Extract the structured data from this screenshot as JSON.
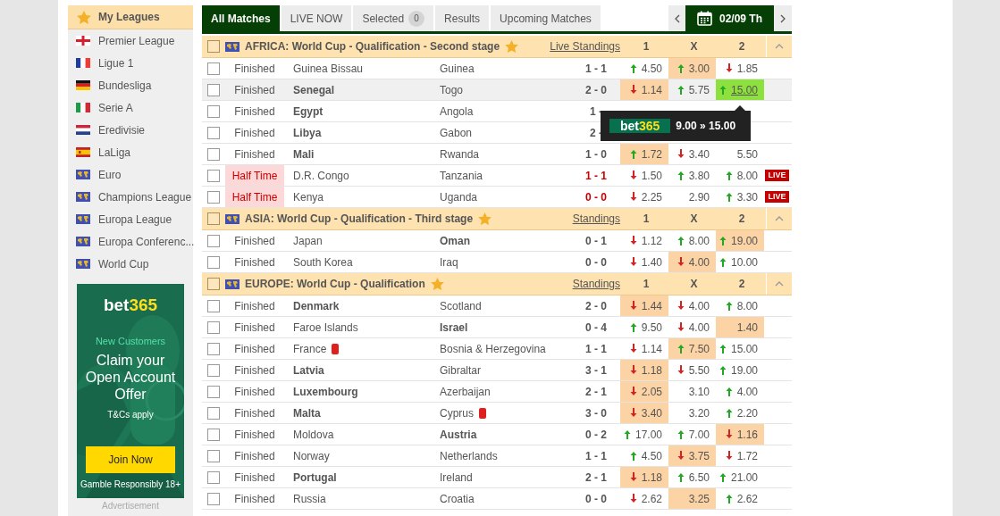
{
  "sidebar": {
    "title": "My Leagues",
    "items": [
      {
        "label": "Premier League",
        "kind": "england"
      },
      {
        "label": "Ligue 1",
        "kind": "france"
      },
      {
        "label": "Bundesliga",
        "kind": "germany"
      },
      {
        "label": "Serie A",
        "kind": "italy"
      },
      {
        "label": "Eredivisie",
        "kind": "netherlands"
      },
      {
        "label": "LaLiga",
        "kind": "spain"
      },
      {
        "label": "Euro",
        "kind": "world"
      },
      {
        "label": "Champions League",
        "kind": "world"
      },
      {
        "label": "Europa League",
        "kind": "world"
      },
      {
        "label": "Europa Conferenc...",
        "kind": "world"
      },
      {
        "label": "World Cup",
        "kind": "world"
      }
    ]
  },
  "ad": {
    "brand": "bet",
    "brand_accent": "365",
    "kicker": "New Customers",
    "headline": "Claim your Open Account Offer",
    "terms": "T&Cs apply",
    "button": "Join Now",
    "footer": "Gamble Responsibly 18+",
    "caption": "Advertisement"
  },
  "tabs": [
    {
      "label": "All Matches",
      "selected": true
    },
    {
      "label": "LIVE NOW",
      "selected": false
    },
    {
      "label": "Selected",
      "selected": false,
      "count": "0"
    },
    {
      "label": "Results",
      "selected": false
    },
    {
      "label": "Upcoming Matches",
      "selected": false
    }
  ],
  "date": "02/09 Th",
  "groups": [
    {
      "title": "AFRICA: World Cup - Qualification - Second stage",
      "checked": false,
      "standings": "Live Standings",
      "columns": [
        "1",
        "X",
        "2"
      ],
      "rows": [
        {
          "checked": false,
          "status": "Finished",
          "live": false,
          "hovered": false,
          "home": {
            "name": "Guinea Bissau",
            "bold": false,
            "red_card": false
          },
          "away": {
            "name": "Guinea",
            "bold": false,
            "red_card": false
          },
          "score": "1 - 1",
          "odds": [
            {
              "value": "4.50",
              "kind": "up",
              "highlighted": false,
              "selected": false
            },
            {
              "value": "3.00",
              "kind": "up",
              "highlighted": true,
              "selected": false
            },
            {
              "value": "1.85",
              "kind": "down",
              "highlighted": false,
              "selected": false
            }
          ]
        },
        {
          "checked": false,
          "status": "Finished",
          "live": false,
          "hovered": true,
          "home": {
            "name": "Senegal",
            "bold": true,
            "red_card": false
          },
          "away": {
            "name": "Togo",
            "bold": false,
            "red_card": false
          },
          "score": "2 - 0",
          "odds": [
            {
              "value": "1.14",
              "kind": "down",
              "highlighted": true,
              "selected": false
            },
            {
              "value": "5.75",
              "kind": "up",
              "highlighted": false,
              "selected": false
            },
            {
              "value": "15.00",
              "kind": "up",
              "highlighted": false,
              "selected": true
            }
          ]
        },
        {
          "checked": false,
          "status": "Finished",
          "live": false,
          "hovered": false,
          "home": {
            "name": "Egypt",
            "bold": true,
            "red_card": false
          },
          "away": {
            "name": "Angola",
            "bold": false,
            "red_card": false
          },
          "score": "1 -"
        },
        {
          "checked": false,
          "status": "Finished",
          "live": false,
          "hovered": false,
          "home": {
            "name": "Libya",
            "bold": true,
            "red_card": false
          },
          "away": {
            "name": "Gabon",
            "bold": false,
            "red_card": false
          },
          "score": "2 -"
        },
        {
          "checked": false,
          "status": "Finished",
          "live": false,
          "hovered": false,
          "home": {
            "name": "Mali",
            "bold": true,
            "red_card": false
          },
          "away": {
            "name": "Rwanda",
            "bold": false,
            "red_card": false
          },
          "score": "1 - 0",
          "odds": [
            {
              "value": "1.72",
              "kind": "up",
              "highlighted": true,
              "selected": false
            },
            {
              "value": "3.40",
              "kind": "down",
              "highlighted": false,
              "selected": false
            },
            {
              "value": "5.50",
              "kind": "flat",
              "highlighted": false,
              "selected": false
            }
          ]
        },
        {
          "checked": false,
          "status": "Half Time",
          "live": true,
          "live_badge": "LIVE",
          "hovered": false,
          "home": {
            "name": "D.R. Congo",
            "bold": false,
            "red_card": false
          },
          "away": {
            "name": "Tanzania",
            "bold": false,
            "red_card": false
          },
          "score": "1 - 1",
          "odds": [
            {
              "value": "1.50",
              "kind": "down",
              "highlighted": false,
              "selected": false
            },
            {
              "value": "3.80",
              "kind": "up",
              "highlighted": false,
              "selected": false
            },
            {
              "value": "8.00",
              "kind": "up",
              "highlighted": false,
              "selected": false
            }
          ]
        },
        {
          "checked": false,
          "status": "Half Time",
          "live": true,
          "live_badge": "LIVE",
          "hovered": false,
          "home": {
            "name": "Kenya",
            "bold": false,
            "red_card": false
          },
          "away": {
            "name": "Uganda",
            "bold": false,
            "red_card": false
          },
          "score": "0 - 0",
          "odds": [
            {
              "value": "2.25",
              "kind": "down",
              "highlighted": false,
              "selected": false
            },
            {
              "value": "2.90",
              "kind": "flat",
              "highlighted": false,
              "selected": false
            },
            {
              "value": "3.30",
              "kind": "up",
              "highlighted": false,
              "selected": false
            }
          ]
        }
      ]
    },
    {
      "title": "ASIA: World Cup - Qualification - Third stage",
      "checked": false,
      "standings": "Standings",
      "columns": [
        "1",
        "X",
        "2"
      ],
      "rows": [
        {
          "checked": false,
          "status": "Finished",
          "live": false,
          "hovered": false,
          "home": {
            "name": "Japan",
            "bold": false,
            "red_card": false
          },
          "away": {
            "name": "Oman",
            "bold": true,
            "red_card": false
          },
          "score": "0 - 1",
          "odds": [
            {
              "value": "1.12",
              "kind": "down",
              "highlighted": false,
              "selected": false
            },
            {
              "value": "8.00",
              "kind": "up",
              "highlighted": false,
              "selected": false
            },
            {
              "value": "19.00",
              "kind": "up",
              "highlighted": true,
              "selected": false
            }
          ]
        },
        {
          "checked": false,
          "status": "Finished",
          "live": false,
          "hovered": false,
          "home": {
            "name": "South Korea",
            "bold": false,
            "red_card": false
          },
          "away": {
            "name": "Iraq",
            "bold": false,
            "red_card": false
          },
          "score": "0 - 0",
          "odds": [
            {
              "value": "1.40",
              "kind": "down",
              "highlighted": false,
              "selected": false
            },
            {
              "value": "4.00",
              "kind": "down",
              "highlighted": true,
              "selected": false
            },
            {
              "value": "10.00",
              "kind": "up",
              "highlighted": false,
              "selected": false
            }
          ]
        }
      ]
    },
    {
      "title": "EUROPE: World Cup - Qualification",
      "checked": false,
      "standings": "Standings",
      "columns": [
        "1",
        "X",
        "2"
      ],
      "rows": [
        {
          "checked": false,
          "status": "Finished",
          "live": false,
          "hovered": false,
          "home": {
            "name": "Denmark",
            "bold": true,
            "red_card": false
          },
          "away": {
            "name": "Scotland",
            "bold": false,
            "red_card": false
          },
          "score": "2 - 0",
          "odds": [
            {
              "value": "1.44",
              "kind": "down",
              "highlighted": true,
              "selected": false
            },
            {
              "value": "4.00",
              "kind": "down",
              "highlighted": false,
              "selected": false
            },
            {
              "value": "8.00",
              "kind": "up",
              "highlighted": false,
              "selected": false
            }
          ]
        },
        {
          "checked": false,
          "status": "Finished",
          "live": false,
          "hovered": false,
          "home": {
            "name": "Faroe Islands",
            "bold": false,
            "red_card": false
          },
          "away": {
            "name": "Israel",
            "bold": true,
            "red_card": false
          },
          "score": "0 - 4",
          "odds": [
            {
              "value": "9.50",
              "kind": "up",
              "highlighted": false,
              "selected": false
            },
            {
              "value": "4.00",
              "kind": "down",
              "highlighted": false,
              "selected": false
            },
            {
              "value": "1.40",
              "kind": "flat",
              "highlighted": true,
              "selected": false
            }
          ]
        },
        {
          "checked": false,
          "status": "Finished",
          "live": false,
          "hovered": false,
          "home": {
            "name": "France",
            "bold": false,
            "red_card": true
          },
          "away": {
            "name": "Bosnia & Herzegovina",
            "bold": false,
            "red_card": false
          },
          "score": "1 - 1",
          "odds": [
            {
              "value": "1.14",
              "kind": "down",
              "highlighted": false,
              "selected": false
            },
            {
              "value": "7.50",
              "kind": "up",
              "highlighted": true,
              "selected": false
            },
            {
              "value": "15.00",
              "kind": "up",
              "highlighted": false,
              "selected": false
            }
          ]
        },
        {
          "checked": false,
          "status": "Finished",
          "live": false,
          "hovered": false,
          "home": {
            "name": "Latvia",
            "bold": true,
            "red_card": false
          },
          "away": {
            "name": "Gibraltar",
            "bold": false,
            "red_card": false
          },
          "score": "3 - 1",
          "odds": [
            {
              "value": "1.18",
              "kind": "down",
              "highlighted": true,
              "selected": false
            },
            {
              "value": "5.50",
              "kind": "down",
              "highlighted": false,
              "selected": false
            },
            {
              "value": "19.00",
              "kind": "up",
              "highlighted": false,
              "selected": false
            }
          ]
        },
        {
          "checked": false,
          "status": "Finished",
          "live": false,
          "hovered": false,
          "home": {
            "name": "Luxembourg",
            "bold": true,
            "red_card": false
          },
          "away": {
            "name": "Azerbaijan",
            "bold": false,
            "red_card": false
          },
          "score": "2 - 1",
          "odds": [
            {
              "value": "2.05",
              "kind": "down",
              "highlighted": true,
              "selected": false
            },
            {
              "value": "3.10",
              "kind": "flat",
              "highlighted": false,
              "selected": false
            },
            {
              "value": "4.00",
              "kind": "up",
              "highlighted": false,
              "selected": false
            }
          ]
        },
        {
          "checked": false,
          "status": "Finished",
          "live": false,
          "hovered": false,
          "home": {
            "name": "Malta",
            "bold": true,
            "red_card": false
          },
          "away": {
            "name": "Cyprus",
            "bold": false,
            "red_card": true
          },
          "score": "3 - 0",
          "odds": [
            {
              "value": "3.40",
              "kind": "down",
              "highlighted": true,
              "selected": false
            },
            {
              "value": "3.20",
              "kind": "flat",
              "highlighted": false,
              "selected": false
            },
            {
              "value": "2.20",
              "kind": "up",
              "highlighted": false,
              "selected": false
            }
          ]
        },
        {
          "checked": false,
          "status": "Finished",
          "live": false,
          "hovered": false,
          "home": {
            "name": "Moldova",
            "bold": false,
            "red_card": false
          },
          "away": {
            "name": "Austria",
            "bold": true,
            "red_card": false
          },
          "score": "0 - 2",
          "odds": [
            {
              "value": "17.00",
              "kind": "up",
              "highlighted": false,
              "selected": false
            },
            {
              "value": "7.00",
              "kind": "up",
              "highlighted": false,
              "selected": false
            },
            {
              "value": "1.16",
              "kind": "down",
              "highlighted": true,
              "selected": false
            }
          ]
        },
        {
          "checked": false,
          "status": "Finished",
          "live": false,
          "hovered": false,
          "home": {
            "name": "Norway",
            "bold": false,
            "red_card": false
          },
          "away": {
            "name": "Netherlands",
            "bold": false,
            "red_card": false
          },
          "score": "1 - 1",
          "odds": [
            {
              "value": "4.50",
              "kind": "up",
              "highlighted": false,
              "selected": false
            },
            {
              "value": "3.75",
              "kind": "down",
              "highlighted": true,
              "selected": false
            },
            {
              "value": "1.72",
              "kind": "down",
              "highlighted": false,
              "selected": false
            }
          ]
        },
        {
          "checked": false,
          "status": "Finished",
          "live": false,
          "hovered": false,
          "home": {
            "name": "Portugal",
            "bold": true,
            "red_card": false
          },
          "away": {
            "name": "Ireland",
            "bold": false,
            "red_card": false
          },
          "score": "2 - 1",
          "odds": [
            {
              "value": "1.18",
              "kind": "down",
              "highlighted": true,
              "selected": false
            },
            {
              "value": "6.50",
              "kind": "up",
              "highlighted": false,
              "selected": false
            },
            {
              "value": "21.00",
              "kind": "up",
              "highlighted": false,
              "selected": false
            }
          ]
        },
        {
          "checked": false,
          "status": "Finished",
          "live": false,
          "hovered": false,
          "home": {
            "name": "Russia",
            "bold": false,
            "red_card": false
          },
          "away": {
            "name": "Croatia",
            "bold": false,
            "red_card": false
          },
          "score": "0 - 0",
          "odds": [
            {
              "value": "2.62",
              "kind": "down",
              "highlighted": false,
              "selected": false
            },
            {
              "value": "3.25",
              "kind": "flat",
              "highlighted": true,
              "selected": false
            },
            {
              "value": "2.62",
              "kind": "up",
              "highlighted": false,
              "selected": false
            }
          ]
        }
      ]
    }
  ],
  "tooltip": {
    "brand": "bet",
    "brand_accent": "365",
    "change": "9.00 » 15.00"
  }
}
